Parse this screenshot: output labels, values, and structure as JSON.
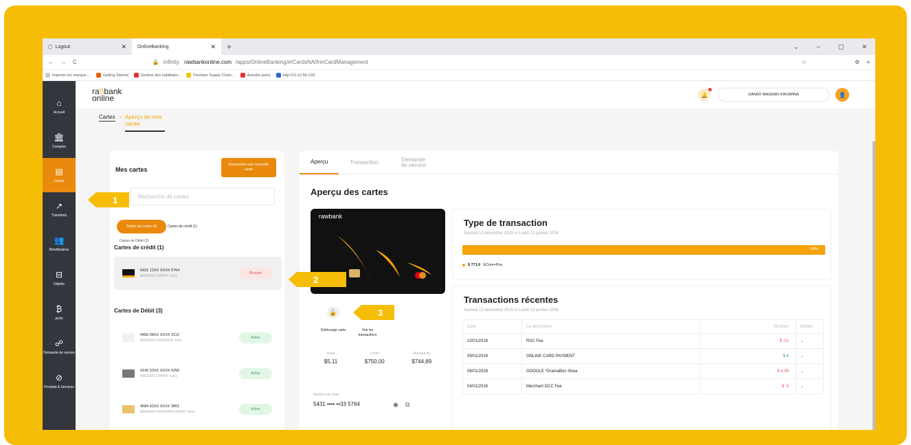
{
  "browser": {
    "tab1": "Logout",
    "tab2": "OnlineBanking",
    "url_pre": "infinity.",
    "url_domain": "rawbankonline.com",
    "url_path": "/apps/OnlineBanking/#/CardsNA/frmCardManagement",
    "bookmarks": [
      "Importer les marque-...",
      "Getting Started",
      "Gestion des habilitatio...",
      "Finshare Supply Chain...",
      "Autodoc.parts",
      "http://10.10.58.126/"
    ]
  },
  "logo": {
    "l1a": "ra",
    "l1b": "\\\\",
    "l1c": "bank",
    "l2": "online"
  },
  "header": {
    "user": "DANNY MASEMO KIKOMINA"
  },
  "sidebar": [
    "Accueil",
    "Comptes",
    "Cartes",
    "Transferts",
    "Bénéficiaires",
    "Dépôts",
    "prets",
    "Demande de service",
    "Produits & Services"
  ],
  "breadcrumb": {
    "c1": "Cartes",
    "c2": "Aperçu de mes cartes"
  },
  "left": {
    "title": "Mes cartes",
    "request": "Demander une nouvelle carte",
    "search_ph": "Recherche de cartes",
    "chip_all": "Toutes les cartes (4)",
    "chip_credit": "Cartes de crédit (1)",
    "debit_small": "Cartes de Débit (3)",
    "credit_title": "Cartes de crédit (1)",
    "debit_title": "Cartes de Débit (3)",
    "cards": [
      {
        "num": "5431 12XX XXXX 5764",
        "holder": "MASEMO DANNY",
        "exp": "xx/xx",
        "status": "Bloquée"
      },
      {
        "num": "4456 08XX XXXX 3113",
        "holder": "MASEMO KIKOMINA",
        "exp": "xx/xx",
        "status": "Active"
      },
      {
        "num": "4196 53XX XXXX 6256",
        "holder": "MASEMO DANNY",
        "exp": "xx/xx",
        "status": "Active"
      },
      {
        "num": "4584 42XX XXXX 3801",
        "holder": "MASEMO KIKOMINA DANNY",
        "exp": "xx/xx",
        "status": "Active"
      }
    ]
  },
  "tabs": [
    "Aperçu",
    "Transaction",
    "Demande de service"
  ],
  "overview": {
    "title": "Aperçu des cartes",
    "brand": "rawbank",
    "unlock": "Déblocage carte",
    "view": "Voir les transactions",
    "stat_labels": [
      "Solde",
      "Limite",
      "Montant dû"
    ],
    "stat_values": [
      "$5,11",
      "$750,00",
      "$744,89"
    ],
    "num_label": "Numéro de carte",
    "num_value": "5431 •••• ••33 5764"
  },
  "type": {
    "title": "Type de transaction",
    "sub": "Samedi 13 décembre 2025 to Lundi 12 janvier 2026",
    "bar_pct": 100,
    "bar_label": "100%",
    "amount": "$ 771.6",
    "legend": "ECom+Pos"
  },
  "recent": {
    "title": "Transactions récentes",
    "sub": "Samedi 13 décembre 2025 to Lundi 12 janvier 2026",
    "cols": [
      "Date",
      "La description",
      "Montant",
      "Détails"
    ],
    "rows": [
      {
        "date": "10/01/2026",
        "desc": "RSC Fee",
        "amt": "$ .01",
        "color": "#e05b5b"
      },
      {
        "date": "09/01/2026",
        "desc": "ONLINE CARD PAYMENT",
        "amt": "$ 4",
        "color": "#3c9c52"
      },
      {
        "date": "08/01/2026",
        "desc": "GOOGLE *DramaBox Strea",
        "amt": "$ 4.99",
        "color": "#e05b5b"
      },
      {
        "date": "04/01/2026",
        "desc": "Merchant DCC Fee",
        "amt": "$ .5",
        "color": "#e05b5b"
      }
    ]
  },
  "callouts": [
    "1",
    "2",
    "3"
  ]
}
